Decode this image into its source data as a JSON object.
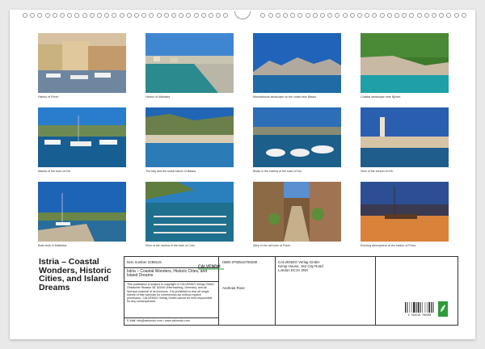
{
  "captions": [
    "Harbor of Porec",
    "Harbor of Malinska",
    "Mountainous landscape on the coast near Baska.",
    "Coastal landscape near Njivice.",
    "Marina of the town of Krk.",
    "The bay and the small harbor of Baska.",
    "Boats in the marina of the town of Krk.",
    "View of the church of Krk.",
    "Boat dock in Malinska.",
    "View of the marina of the town of Cres.",
    "Alley in the old town of Porec.",
    "Evening atmosphere at the harbor of Porec"
  ],
  "title": "Istria – Coastal Wonders, Historic Cities, and Island Dreams",
  "info": {
    "item_number": "Item number 2288115",
    "publisher_logo": "CALVENDO",
    "isbn": "ISBN 9783516780280",
    "publisher_name": "CALVENDO Verlag GmbH",
    "publisher_address_1": "Kemp House, 152 City Road",
    "publisher_address_2": "London EC1V 2NX",
    "title_small": "Istria – Coastal Wonders, Historic Cities, and Island Dreams",
    "author": "Andreas Rose",
    "disclaimer": "This publication is subject to copyright of CALVENDO Verlag GmbH, Ohlsdorfer Strasse 38, 82049 Unterhaching, Germany, and all licensed material of its licensors. It is prohibited to tear off single sheets of this calendar for commercial use without explicit permission. CALVENDO Verlag GmbH cannot be held responsible for any consequences.",
    "email": "E-Mail: info@calvendo.com • www.calvendo.com",
    "barcode_number": "9 783516 780280"
  },
  "colors": {
    "page": "#ffffff",
    "background": "#e9e9e9",
    "logo_green": "#2f9a3a"
  }
}
